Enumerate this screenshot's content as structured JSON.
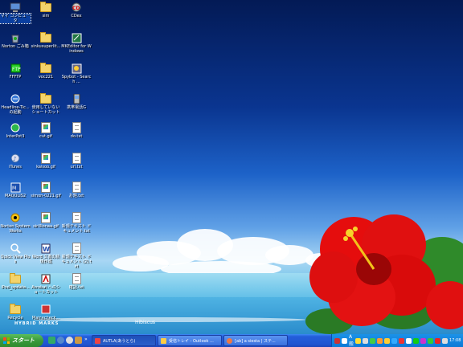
{
  "desktop": {
    "icons": [
      {
        "label": "マイ コンピュータ",
        "icon": "computer-icon"
      },
      {
        "label": "Norton ごみ箱",
        "icon": "recycle-bin-icon"
      },
      {
        "label": "FFFTP",
        "icon": "ffftp-icon"
      },
      {
        "label": "Headline-Tic... の起動",
        "icon": "headline-icon"
      },
      {
        "label": "InterPot3",
        "icon": "interpot-icon"
      },
      {
        "label": "iTunes",
        "icon": "itunes-icon"
      },
      {
        "label": "MAQOLIS2",
        "icon": "maqolis-icon"
      },
      {
        "label": "Norton SystemWorks",
        "icon": "norton-icon"
      },
      {
        "label": "Quick View Plus",
        "icon": "quickview-icon"
      },
      {
        "label": "iPod_update...",
        "icon": "folder-icon"
      },
      {
        "label": "Recycle",
        "icon": "folder-icon"
      },
      {
        "label": "sim",
        "icon": "folder-icon"
      },
      {
        "label": "sinkusuperlit...",
        "icon": "folder-icon"
      },
      {
        "label": "voc221",
        "icon": "folder-icon"
      },
      {
        "label": "使用していない ショートカット",
        "icon": "folder-icon"
      },
      {
        "label": "cut.gif",
        "icon": "gif-icon"
      },
      {
        "label": "kaisoo.gif",
        "icon": "gif-icon"
      },
      {
        "label": "simon-0221.gif",
        "icon": "gif-icon"
      },
      {
        "label": "sirillionaa.gif",
        "icon": "gif-icon"
      },
      {
        "label": "Word 文書の新規作成",
        "icon": "word-icon"
      },
      {
        "label": "Acrobat へのショートカット",
        "icon": "acrobat-icon"
      },
      {
        "label": "Mainecheck...",
        "icon": "app-icon"
      },
      {
        "label": "CDex",
        "icon": "cdex-icon"
      },
      {
        "label": "MKEditor for Windows",
        "icon": "mkeditor-icon"
      },
      {
        "label": "Spybot - Search ...",
        "icon": "spybot-icon"
      },
      {
        "label": "携帯電話G",
        "icon": "phone-icon"
      },
      {
        "label": "do.txt",
        "icon": "text-file-icon"
      },
      {
        "label": "url.txt",
        "icon": "text-file-icon"
      },
      {
        "label": "お題.txt",
        "icon": "text-file-icon"
      },
      {
        "label": "新規テキスト ドキュメント.txt",
        "icon": "text-file-icon"
      },
      {
        "label": "新規テキスト ドキュメント (2).txt",
        "icon": "text-file-icon"
      },
      {
        "label": "確認.txt",
        "icon": "text-file-icon"
      }
    ],
    "wallpaper_credit": "Hibiscus",
    "wallpaper_brand": "HYBRID MARKS"
  },
  "taskbar": {
    "start_label": "スタート",
    "tasks": [
      {
        "label": "AUTLA(あうとら)",
        "icon": "window-icon"
      },
      {
        "label": "受信トレイ - Outlook ...",
        "icon": "outlook-icon"
      },
      {
        "label": "[ab] a siesta | ステ...",
        "icon": "browser-icon"
      }
    ],
    "language_indicator": "A 般",
    "clock": "17:08"
  },
  "colors": {
    "taskbar": "#245edb",
    "start": "#3a9a3a",
    "tray": "#0d79d6"
  }
}
